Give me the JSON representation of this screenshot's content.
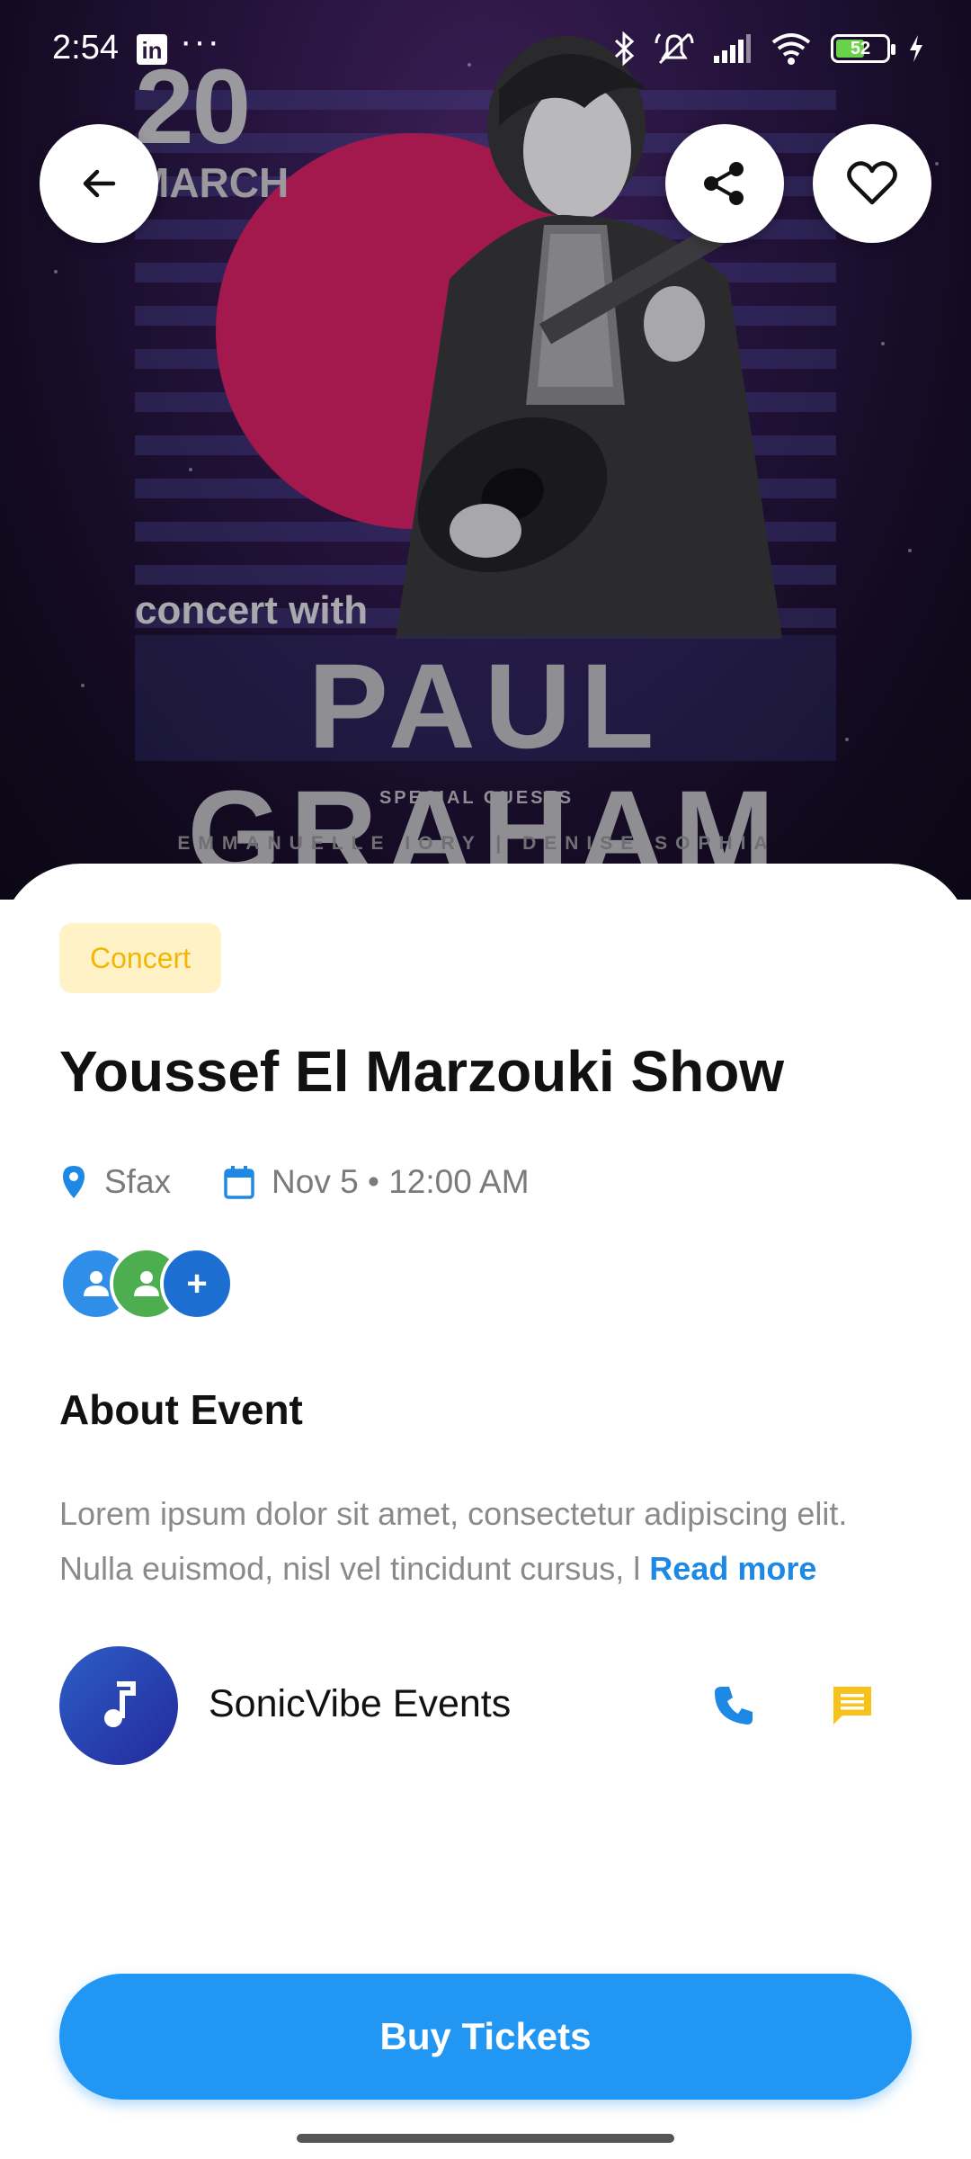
{
  "status_bar": {
    "time": "2:54",
    "linkedin_badge": "in",
    "more": "···",
    "battery_level": "52"
  },
  "poster": {
    "date_day": "20",
    "date_month": "MARCH",
    "subtitle": "concert with",
    "headliner": "PAUL GRAHAM",
    "guests_label": "SPECIAL GUESTS",
    "guests": "EMMANUELLE IORY | DENISE SOPHIA"
  },
  "actions": {
    "back_icon": "arrow-left-icon",
    "share_icon": "share-icon",
    "favorite_icon": "heart-outline-icon"
  },
  "event": {
    "category": "Concert",
    "title": "Youssef El Marzouki Show",
    "location": "Sfax",
    "datetime": "Nov 5 • 12:00 AM",
    "attendees_more": "+"
  },
  "about": {
    "title": "About Event",
    "text": "Lorem ipsum dolor sit amet, consectetur adipiscing elit. Nulla euismod, nisl vel tincidunt cursus, l",
    "read_more": "Read more"
  },
  "organizer": {
    "name": "SonicVibe Events",
    "avatar_icon": "music-note-icon",
    "call_icon": "phone-icon",
    "message_icon": "chat-icon"
  },
  "cta": {
    "label": "Buy Tickets"
  },
  "colors": {
    "primary": "#2196f3",
    "chip_bg": "#fff2c6",
    "chip_text": "#f2b705",
    "message_icon": "#f7c21a"
  }
}
